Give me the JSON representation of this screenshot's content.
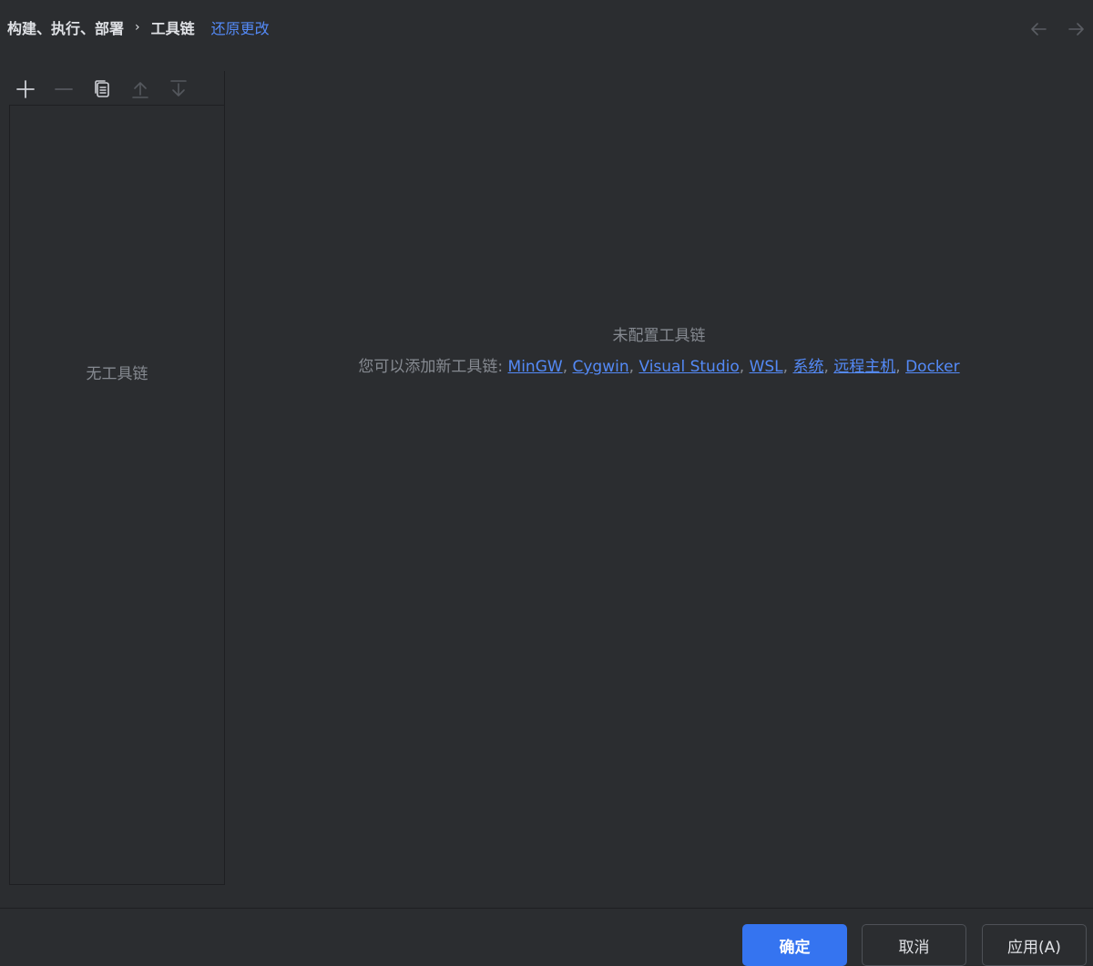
{
  "breadcrumb": {
    "parent": "构建、执行、部署",
    "separator": "›",
    "current": "工具链",
    "reset_link": "还原更改"
  },
  "nav": {
    "back_icon": "arrow-left-icon",
    "forward_icon": "arrow-right-icon"
  },
  "toolbar": {
    "icons": [
      "add-icon",
      "remove-icon",
      "copy-icon",
      "move-up-icon",
      "move-down-icon"
    ]
  },
  "list": {
    "empty_text": "无工具链"
  },
  "empty_state": {
    "title": "未配置工具链",
    "desc_prefix": "您可以添加新工具链: ",
    "links": [
      "MinGW",
      "Cygwin",
      "Visual Studio",
      "WSL",
      "系统",
      "远程主机",
      "Docker"
    ],
    "link_separator": ", "
  },
  "footer": {
    "ok_label": "确定",
    "cancel_label": "取消",
    "apply_label": "应用(A)"
  },
  "colors": {
    "background": "#2b2d30",
    "accent": "#3574f0",
    "link": "#548af7",
    "muted_text": "#868a91"
  }
}
